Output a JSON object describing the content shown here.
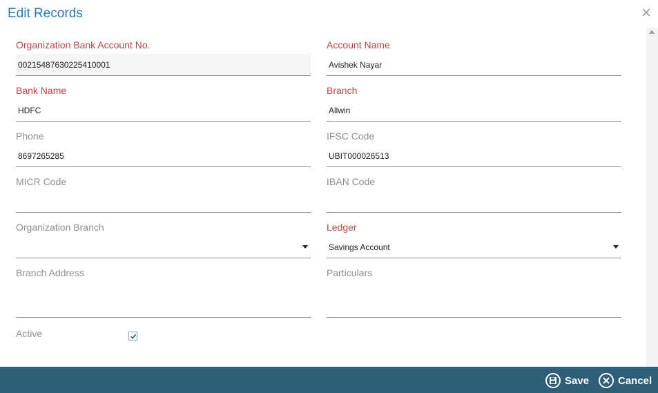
{
  "dialog": {
    "title": "Edit Records"
  },
  "fields": {
    "org_bank_account_no": {
      "label": "Organization Bank Account No.",
      "value": "00215487630225410001"
    },
    "account_name": {
      "label": "Account Name",
      "value": "Avishek Nayar"
    },
    "bank_name": {
      "label": "Bank Name",
      "value": "HDFC"
    },
    "branch": {
      "label": "Branch",
      "value": "Allwin"
    },
    "phone": {
      "label": "Phone",
      "value": "8697265285"
    },
    "ifsc_code": {
      "label": "IFSC Code",
      "value": "UBIT000026513"
    },
    "micr_code": {
      "label": "MICR Code",
      "value": ""
    },
    "iban_code": {
      "label": "IBAN Code",
      "value": ""
    },
    "org_branch": {
      "label": "Organization Branch",
      "value": ""
    },
    "ledger": {
      "label": "Ledger",
      "value": "Savings Account"
    },
    "branch_address": {
      "label": "Branch Address",
      "value": ""
    },
    "particulars": {
      "label": "Particulars",
      "value": ""
    },
    "active": {
      "label": "Active",
      "checked": true
    }
  },
  "footer": {
    "save_label": "Save",
    "cancel_label": "Cancel"
  },
  "colors": {
    "title": "#2a7ab5",
    "required_label": "#b94646",
    "optional_label": "#8f8f8f",
    "footer_bg": "#2f5f76"
  },
  "icons": {
    "close": "close-icon",
    "save": "floppy-disk-icon",
    "cancel": "x-circle-icon",
    "dropdown": "caret-down-icon",
    "check": "checkmark-icon"
  }
}
